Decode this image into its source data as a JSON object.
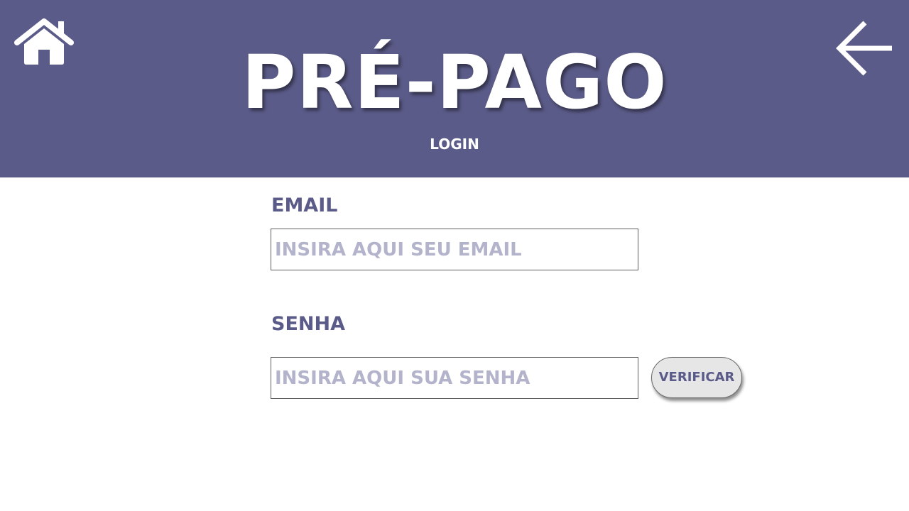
{
  "header": {
    "title": "PRÉ-PAGO",
    "subtitle": "LOGIN",
    "home_icon": "home-icon",
    "back_icon": "arrow-left-icon",
    "background_color": "#5b5b89"
  },
  "form": {
    "email": {
      "label": "EMAIL",
      "placeholder": "INSIRA AQUI SEU EMAIL",
      "value": ""
    },
    "password": {
      "label": "SENHA",
      "placeholder": "INSIRA AQUI SUA SENHA",
      "value": ""
    },
    "verify_label": "VERIFICAR"
  },
  "colors": {
    "accent": "#5b5b89",
    "placeholder": "#b3b3cc",
    "button_bg": "#e6e6e6",
    "page_bg": "#ffffff"
  }
}
